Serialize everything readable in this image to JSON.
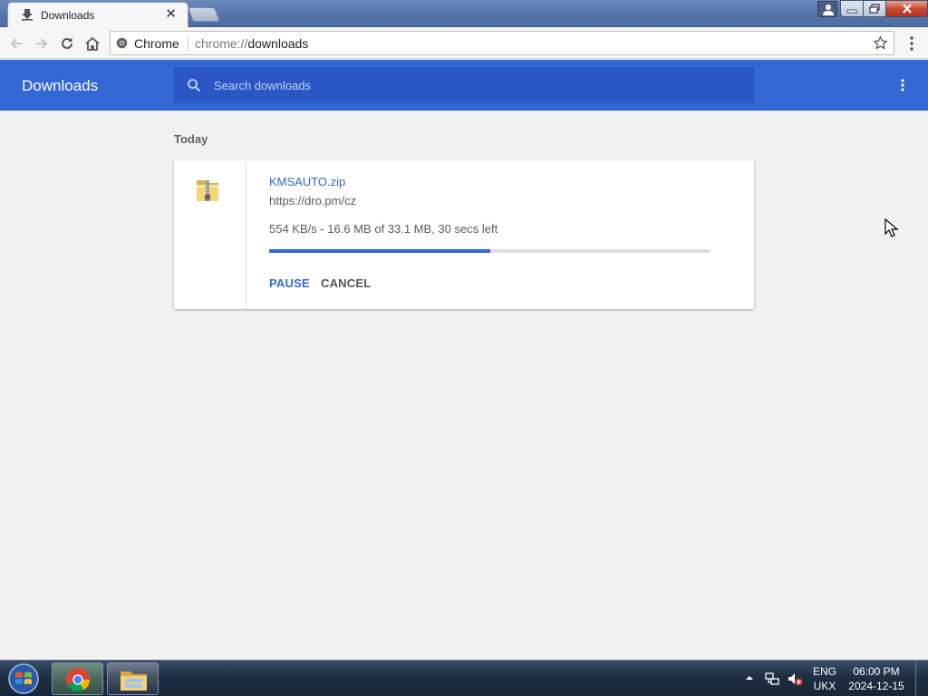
{
  "browser": {
    "tab": {
      "title": "Downloads"
    },
    "omnibox": {
      "site_chip": "Chrome",
      "url_scheme": "chrome://",
      "url_path": "downloads"
    }
  },
  "downloads_page": {
    "title": "Downloads",
    "search": {
      "placeholder": "Search downloads",
      "value": ""
    },
    "date_group": "Today",
    "items": [
      {
        "file_name": "KMSAUTO.zip",
        "source_url": "https://dro.pm/cz",
        "status": "554 KB/s - 16.6 MB of 33.1 MB, 30 secs left",
        "progress_fraction": 0.5,
        "actions": {
          "pause": "PAUSE",
          "cancel": "CANCEL"
        }
      }
    ]
  },
  "taskbar": {
    "language": {
      "code": "ENG",
      "layout": "UKX"
    },
    "clock": {
      "time": "06:00 PM",
      "date": "2024-12-15"
    },
    "pinned": [
      "chrome-icon",
      "file-explorer-icon"
    ]
  },
  "colors": {
    "accent": "#3367d6",
    "header_bg": "#3367d6",
    "search_bg": "#2a56c6",
    "page_bg": "#f1f1f1"
  }
}
